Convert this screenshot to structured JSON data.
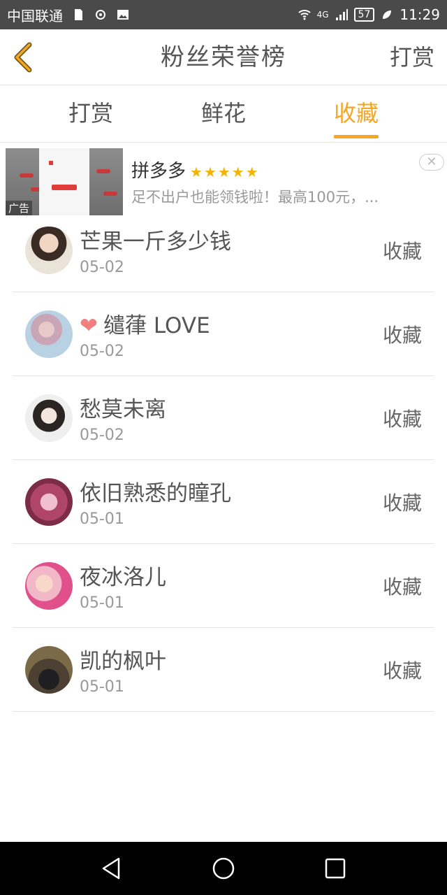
{
  "statusbar": {
    "carrier": "中国联通",
    "network": "4G",
    "battery": "57",
    "time": "11:29"
  },
  "header": {
    "title": "粉丝荣誉榜",
    "right_action": "打赏"
  },
  "tabs": [
    {
      "label": "打赏",
      "active": false
    },
    {
      "label": "鲜花",
      "active": false
    },
    {
      "label": "收藏",
      "active": true
    }
  ],
  "ad": {
    "title": "拼多多",
    "stars": "★★★★★",
    "description": "足不出户也能领钱啦！最高100元，...",
    "tag": "广告",
    "close": "✕"
  },
  "list": [
    {
      "name": "芒果一斤多少钱",
      "date": "05-02",
      "action": "收藏",
      "heart": false
    },
    {
      "name": "缱葎 LOVE",
      "date": "05-02",
      "action": "收藏",
      "heart": true
    },
    {
      "name": "愁莫未离",
      "date": "05-02",
      "action": "收藏",
      "heart": false
    },
    {
      "name": "依旧熟悉的瞳孔",
      "date": "05-01",
      "action": "收藏",
      "heart": false
    },
    {
      "name": "夜冰洛儿",
      "date": "05-01",
      "action": "收藏",
      "heart": false
    },
    {
      "name": "凯的枫叶",
      "date": "05-01",
      "action": "收藏",
      "heart": false
    }
  ],
  "colors": {
    "accent": "#f5a623",
    "text": "#555555",
    "muted": "#999999"
  }
}
